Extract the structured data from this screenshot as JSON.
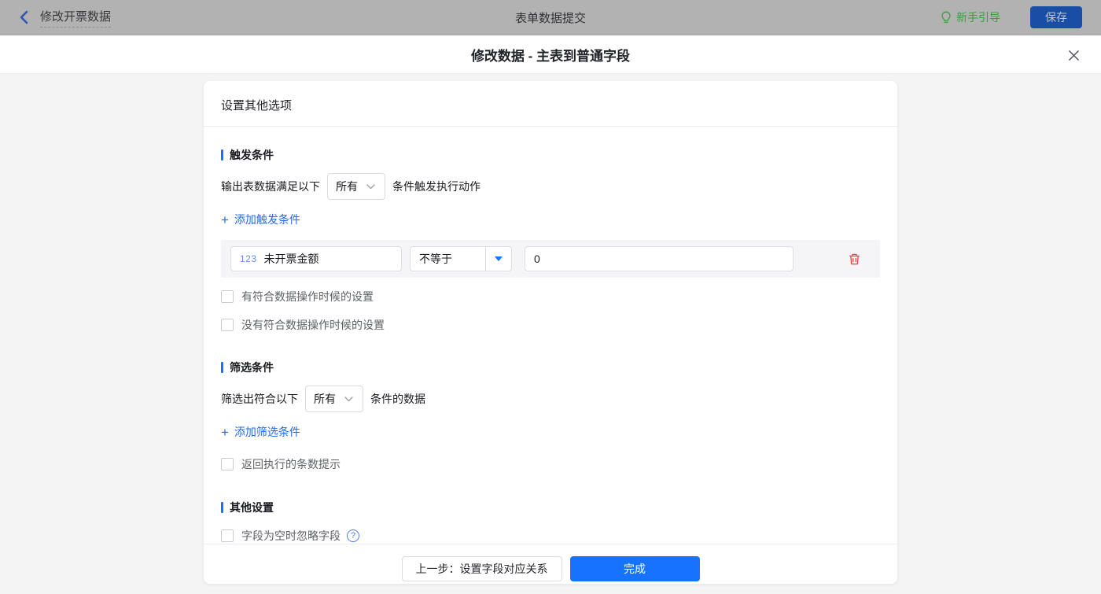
{
  "topbar": {
    "back_label": "修改开票数据",
    "title": "表单数据提交",
    "guide_label": "新手引导",
    "save_label": "保存"
  },
  "modal": {
    "title": "修改数据 - 主表到普通字段",
    "card_title": "设置其他选项",
    "trigger": {
      "heading": "触发条件",
      "sentence_prefix": "输出表数据满足以下",
      "match_value": "所有",
      "sentence_suffix": "条件触发执行动作",
      "add_label": "添加触发条件",
      "condition": {
        "field_type_badge": "123",
        "field_name": "未开票金额",
        "operator": "不等于",
        "value": "0"
      },
      "checkboxes": [
        "有符合数据操作时候的设置",
        "没有符合数据操作时候的设置"
      ]
    },
    "filter": {
      "heading": "筛选条件",
      "sentence_prefix": "筛选出符合以下",
      "match_value": "所有",
      "sentence_suffix": "条件的数据",
      "add_label": "添加筛选条件",
      "checkbox_label": "返回执行的条数提示"
    },
    "other": {
      "heading": "其他设置",
      "checkbox_label": "字段为空时忽略字段"
    },
    "footer": {
      "prev_label": "上一步：设置字段对应关系",
      "done_label": "完成"
    }
  },
  "colors": {
    "accent_blue": "#1672ff",
    "link_blue": "#2468f2",
    "danger_red": "#f13f46",
    "guide_green": "#3f9d42",
    "dimmed_bar": "#b2b2b2"
  }
}
